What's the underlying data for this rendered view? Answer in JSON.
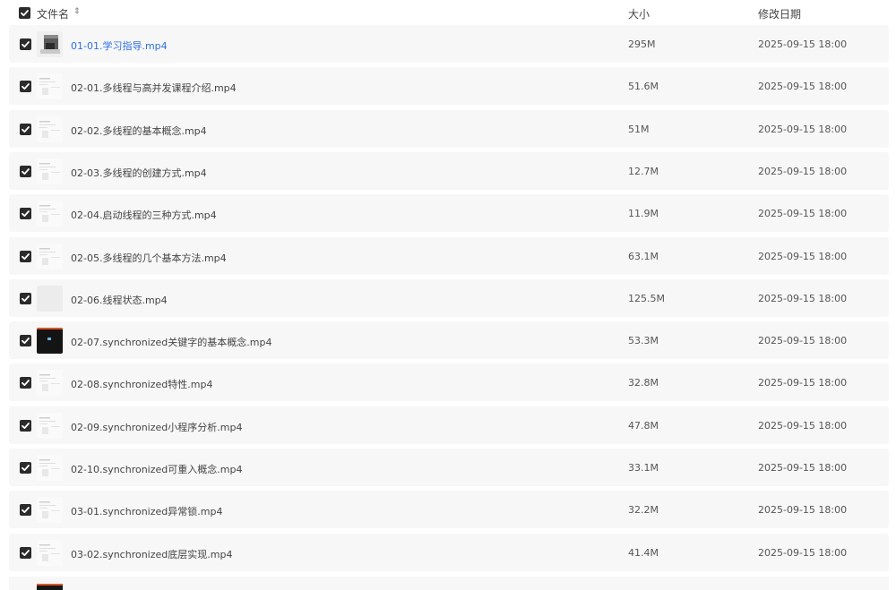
{
  "header": {
    "name_label": "文件名",
    "sort_icon": "⇕",
    "size_label": "大小",
    "date_label": "修改日期"
  },
  "files": [
    {
      "name": "01-01.学习指导.mp4",
      "size": "295M",
      "date": "2025-09-15 18:00",
      "thumb": "photo",
      "link": true
    },
    {
      "name": "02-01.多线程与高并发课程介绍.mp4",
      "size": "51.6M",
      "date": "2025-09-15 18:00",
      "thumb": "doc",
      "link": false
    },
    {
      "name": "02-02.多线程的基本概念.mp4",
      "size": "51M",
      "date": "2025-09-15 18:00",
      "thumb": "doc",
      "link": false
    },
    {
      "name": "02-03.多线程的创建方式.mp4",
      "size": "12.7M",
      "date": "2025-09-15 18:00",
      "thumb": "doc",
      "link": false
    },
    {
      "name": "02-04.启动线程的三种方式.mp4",
      "size": "11.9M",
      "date": "2025-09-15 18:00",
      "thumb": "doc",
      "link": false
    },
    {
      "name": "02-05.多线程的几个基本方法.mp4",
      "size": "63.1M",
      "date": "2025-09-15 18:00",
      "thumb": "doc",
      "link": false
    },
    {
      "name": "02-06.线程状态.mp4",
      "size": "125.5M",
      "date": "2025-09-15 18:00",
      "thumb": "blank",
      "link": false
    },
    {
      "name": "02-07.synchronized关键字的基本概念.mp4",
      "size": "53.3M",
      "date": "2025-09-15 18:00",
      "thumb": "dark",
      "link": false
    },
    {
      "name": "02-08.synchronized特性.mp4",
      "size": "32.8M",
      "date": "2025-09-15 18:00",
      "thumb": "doc",
      "link": false
    },
    {
      "name": "02-09.synchronized小程序分析.mp4",
      "size": "47.8M",
      "date": "2025-09-15 18:00",
      "thumb": "doc",
      "link": false
    },
    {
      "name": "02-10.synchronized可重入概念.mp4",
      "size": "33.1M",
      "date": "2025-09-15 18:00",
      "thumb": "doc",
      "link": false
    },
    {
      "name": "03-01.synchronized异常锁.mp4",
      "size": "32.2M",
      "date": "2025-09-15 18:00",
      "thumb": "doc",
      "link": false
    },
    {
      "name": "03-02.synchronized底层实现.mp4",
      "size": "41.4M",
      "date": "2025-09-15 18:00",
      "thumb": "doc",
      "link": false
    }
  ],
  "colors": {
    "link": "#2f6fe0",
    "row_bg": "#f7f7f7",
    "checkbox": "#2b2b2b"
  }
}
